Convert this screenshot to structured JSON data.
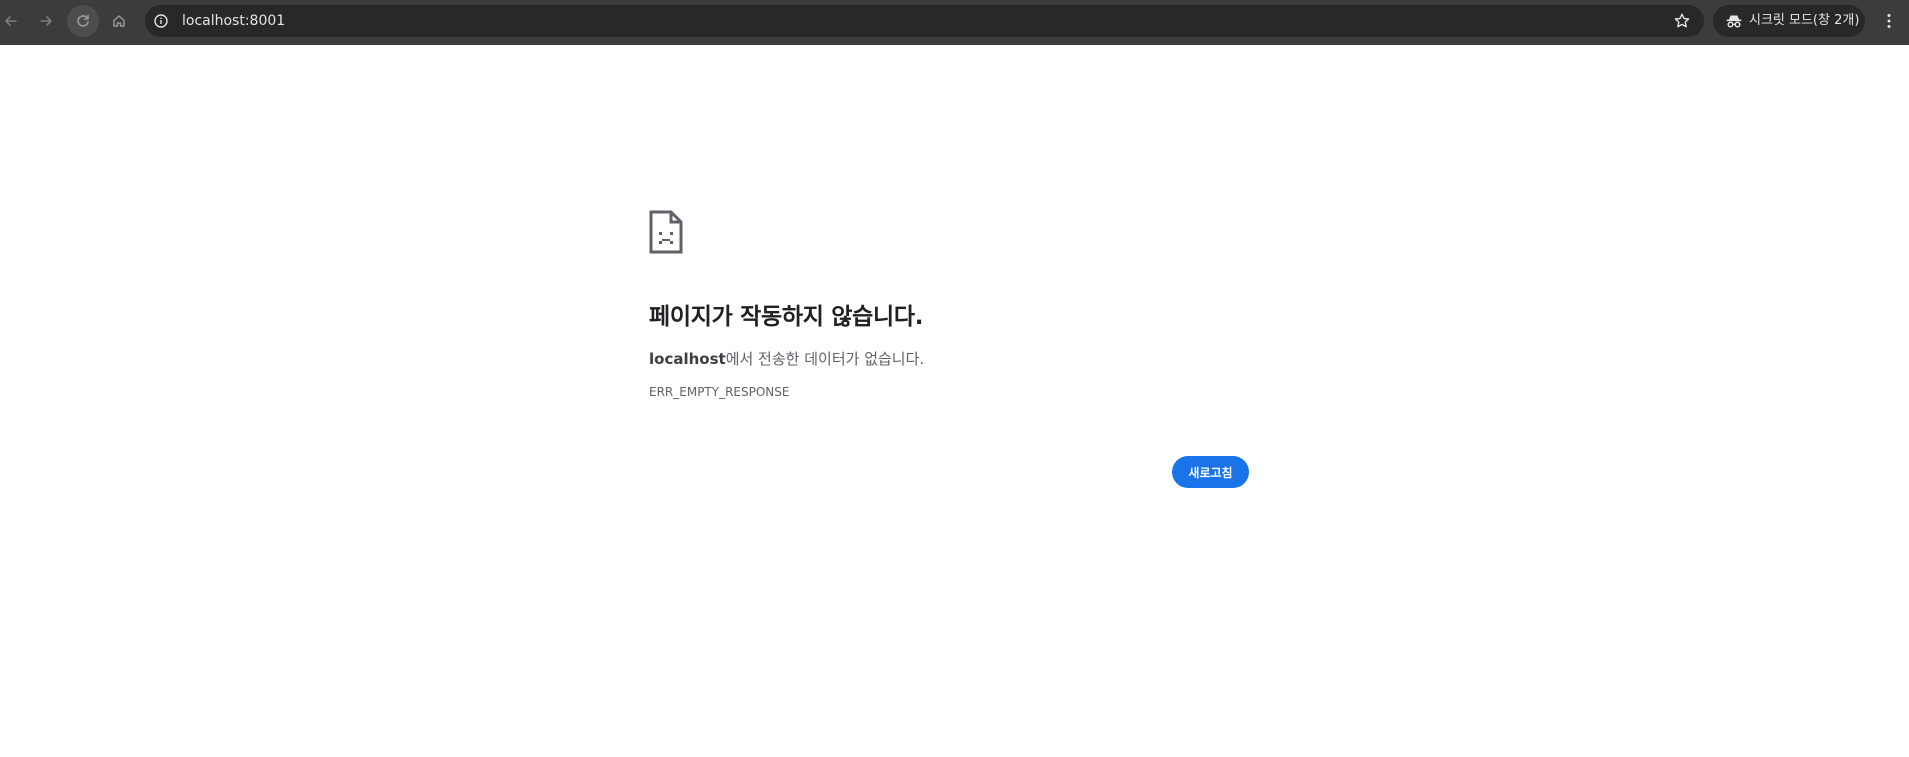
{
  "browser": {
    "url": "localhost:8001",
    "incognito_label": "시크릿 모드(창 2개)",
    "icons": {
      "back": "arrow-left-icon",
      "forward": "arrow-right-icon",
      "reload": "reload-icon",
      "home": "home-icon",
      "site_info": "info-icon",
      "bookmark": "star-icon",
      "incognito": "incognito-icon",
      "menu": "kebab-menu-icon"
    }
  },
  "error_page": {
    "icon": "sad-document-icon",
    "title": "페이지가 작동하지 않습니다.",
    "host": "localhost",
    "description_suffix": "에서 전송한 데이터가 없습니다.",
    "error_code": "ERR_EMPTY_RESPONSE",
    "reload_button": "새로고침"
  },
  "colors": {
    "toolbar_bg": "#3c3c3c",
    "omnibox_bg": "#282828",
    "button_blue": "#1a73e8",
    "title_text": "#202124",
    "secondary_text": "#5f6368"
  }
}
